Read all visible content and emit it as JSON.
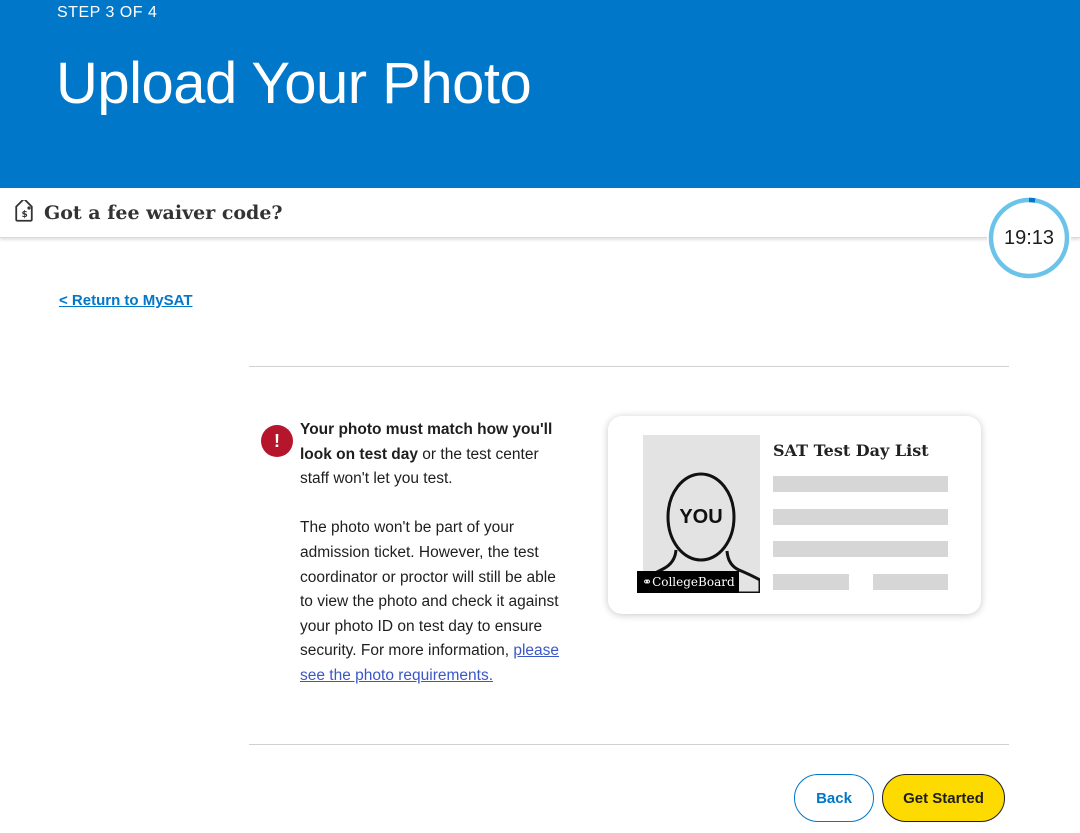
{
  "header": {
    "step": "STEP 3 OF 4",
    "title": "Upload Your Photo"
  },
  "waiver": {
    "label": "Got a fee waiver code?",
    "icon": "tag-dollar-icon"
  },
  "timer": {
    "value": "19:13",
    "ring_color": "#6cc3ea"
  },
  "nav": {
    "return_link": "< Return to MySAT"
  },
  "notice": {
    "icon": "exclamation-alert-icon",
    "bold_text": "Your photo must match how you'll look on test day",
    "rest_text": " or the test center staff won't let you test.",
    "paragraph2": "The photo won't be part of your admission ticket. However, the test coordinator or proctor will still be able to view the photo and check it against your photo ID on test day to ensure security. For more information, ",
    "link_text": "please see the photo requirements."
  },
  "card": {
    "title": "SAT Test Day List",
    "face_label": "YOU",
    "logo_text": "CollegeBoard"
  },
  "buttons": {
    "back": "Back",
    "start": "Get Started"
  },
  "colors": {
    "brand_blue": "#0077c8",
    "cta_yellow": "#fedb00",
    "alert_red": "#b5162b"
  }
}
